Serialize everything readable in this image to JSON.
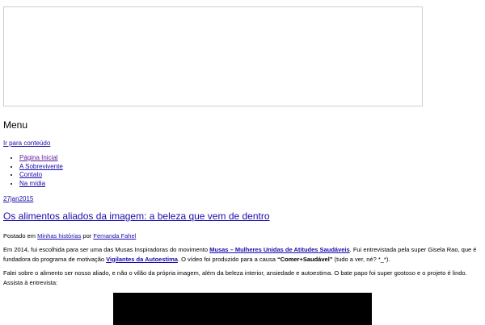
{
  "menu": {
    "title": "Menu",
    "skip_link": "Ir para conteúdo",
    "items": [
      {
        "label": "Página Inicial"
      },
      {
        "label": "A Sobrevivente"
      },
      {
        "label": "Contato"
      },
      {
        "label": "Na mídia"
      }
    ]
  },
  "post": {
    "date": "27jan2015",
    "title": "Os alimentos aliados da imagem: a beleza que vem de dentro",
    "meta": {
      "posted_in": "Postado em",
      "category": "Minhas histórias",
      "by": "por",
      "author": "Fernanda Fahel"
    },
    "paragraph1": {
      "t1": "Em 2014, fui escolhida para ser uma das Musas Inspiradoras do movimento ",
      "link1": "Musas – Mulheres Unidas de Atitudes Saudáveis",
      "t2": ". Fui entrevistada pela super Gisela Rao, que é fundadora do programa de motivação ",
      "link2": "Vigilantes da Autoestima",
      "t3": ". O vídeo foi produzido para a causa ",
      "bold": "“Comer+Saudável”",
      "t4": " (tudo a ver, né? *_*)."
    },
    "paragraph2": "Falei sobre o alimento ser nosso aliado, e não o vilão da própria imagem, além da beleza interior, ansiedade e autoestima. O bate papo foi super gostoso e o projeto é lindo. Assista à entrevista:"
  },
  "colors": {
    "link": "#1a0dab",
    "visited_link": "#5b1a9a",
    "banner_border": "#cfcfcf",
    "video_bg": "#000000"
  }
}
